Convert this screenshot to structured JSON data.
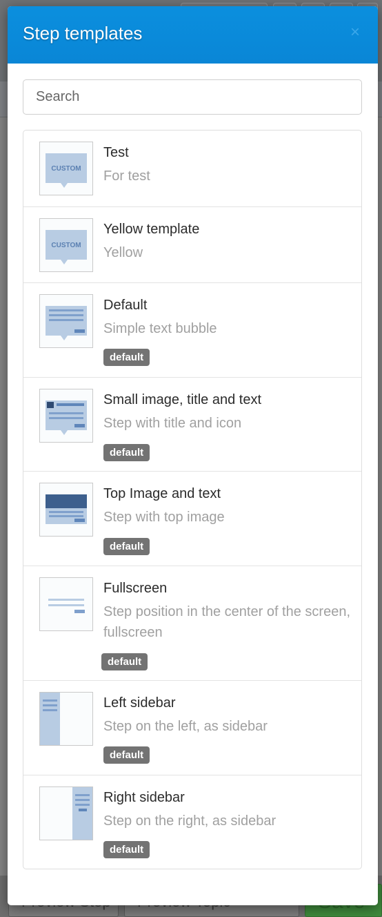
{
  "modal": {
    "title": "Step templates",
    "close_glyph": "×",
    "search_placeholder": "Search"
  },
  "background": {
    "footer_buttons": [
      "Preview Step",
      "Preview Topic",
      "Save"
    ]
  },
  "templates": [
    {
      "title": "Test",
      "description": "For test",
      "badge": null,
      "icon": "custom-bubble-icon",
      "thumb_label": "CUSTOM"
    },
    {
      "title": "Yellow template",
      "description": "Yellow",
      "badge": null,
      "icon": "custom-bubble-icon",
      "thumb_label": "CUSTOM"
    },
    {
      "title": "Default",
      "description": "Simple text bubble",
      "badge": "default",
      "icon": "text-bubble-icon"
    },
    {
      "title": "Small image, title and text",
      "description": "Step with title and icon",
      "badge": "default",
      "icon": "image-title-bubble-icon"
    },
    {
      "title": "Top Image and text",
      "description": "Step with top image",
      "badge": "default",
      "icon": "top-image-icon"
    },
    {
      "title": "Fullscreen",
      "description": "Step position in the center of the screen, fullscreen",
      "badge": "default",
      "icon": "fullscreen-icon"
    },
    {
      "title": "Left sidebar",
      "description": "Step on the left, as sidebar",
      "badge": "default",
      "icon": "left-sidebar-icon"
    },
    {
      "title": "Right sidebar",
      "description": "Step on the right, as sidebar",
      "badge": "default",
      "icon": "right-sidebar-icon"
    }
  ],
  "colors": {
    "header_blue": "#0a8ad9",
    "thumb_blue": "#b8cce3",
    "thumb_dark_blue": "#3d5f8d",
    "badge_gray": "#737373"
  }
}
